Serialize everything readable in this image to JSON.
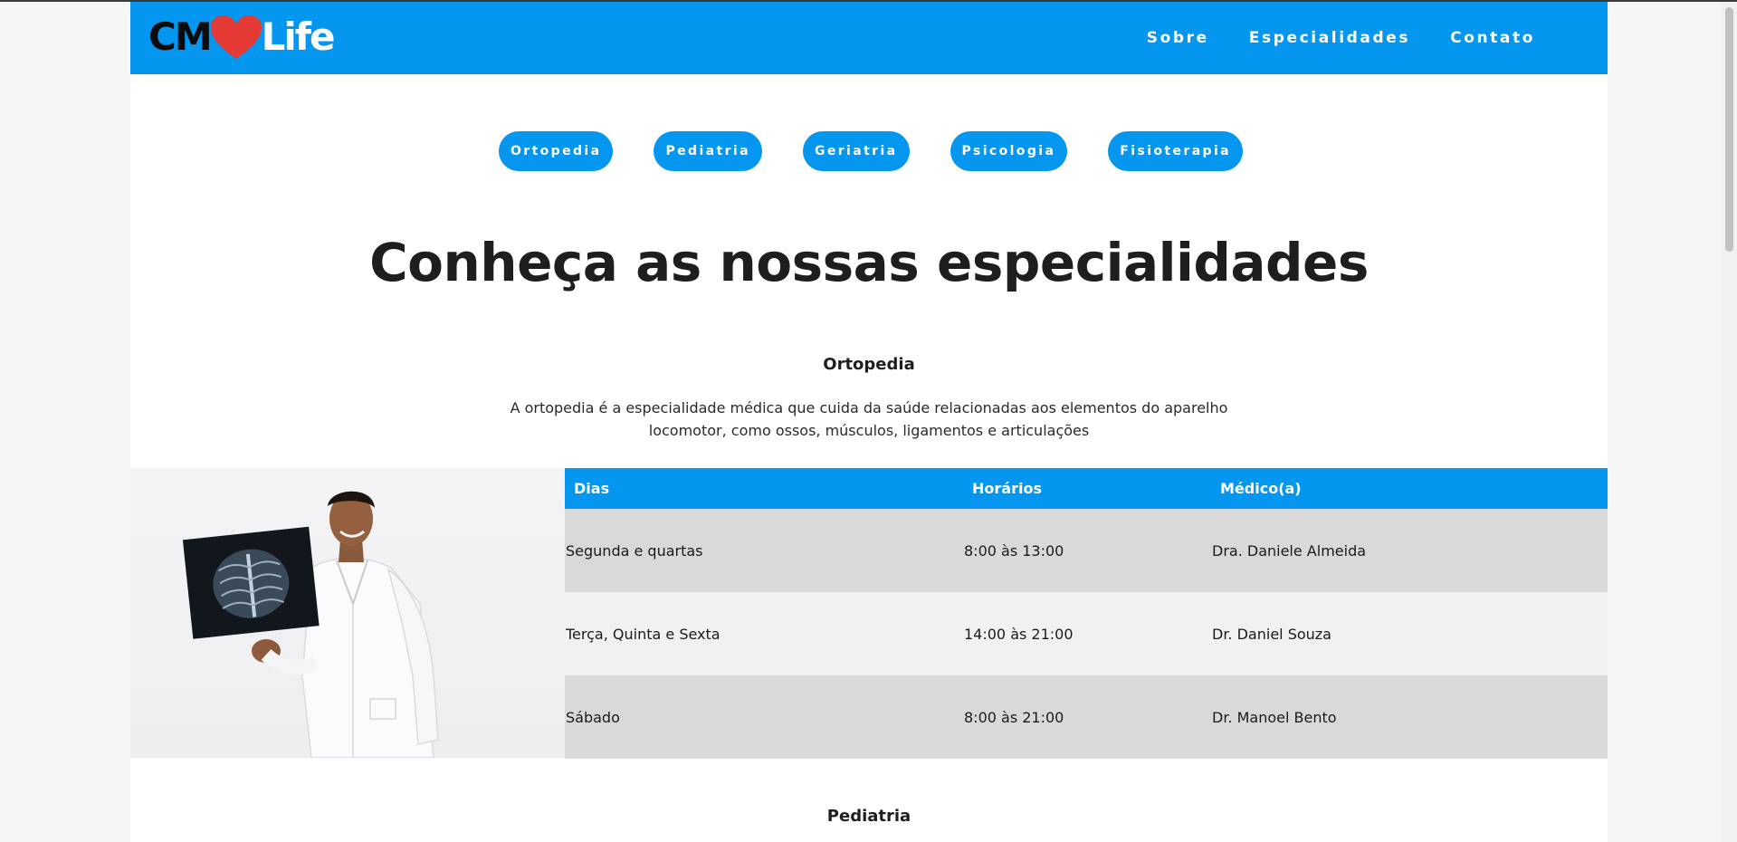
{
  "brand": {
    "logo_left": "CM",
    "logo_right": "Life",
    "heart_color": "#e53935"
  },
  "nav": {
    "items": [
      "Sobre",
      "Especialidades",
      "Contato"
    ]
  },
  "specialty_tabs": [
    "Ortopedia",
    "Pediatria",
    "Geriatria",
    "Psicologia",
    "Fisioterapia"
  ],
  "page_title": "Conheça as nossas especialidades",
  "sections": [
    {
      "title": "Ortopedia",
      "description_lines": [
        "A ortopedia é a especialidade médica que cuida da saúde relacionadas aos elementos do aparelho",
        "locomotor, como ossos, músculos, ligamentos e articulações"
      ],
      "table": {
        "headers": [
          "Dias",
          "Horários",
          "Médico(a)"
        ],
        "rows": [
          [
            "Segunda e quartas",
            "8:00 às 13:00",
            "Dra. Daniele Almeida"
          ],
          [
            "Terça, Quinta e Sexta",
            "14:00 às 21:00",
            "Dr. Daniel Souza"
          ],
          [
            "Sábado",
            "8:00 às 21:00",
            "Dr. Manoel Bento"
          ]
        ]
      }
    },
    {
      "title": "Pediatria"
    }
  ],
  "colors": {
    "primary": "#0596ef",
    "row_dark": "#d9d9d9",
    "row_light": "#f1f1f1"
  }
}
